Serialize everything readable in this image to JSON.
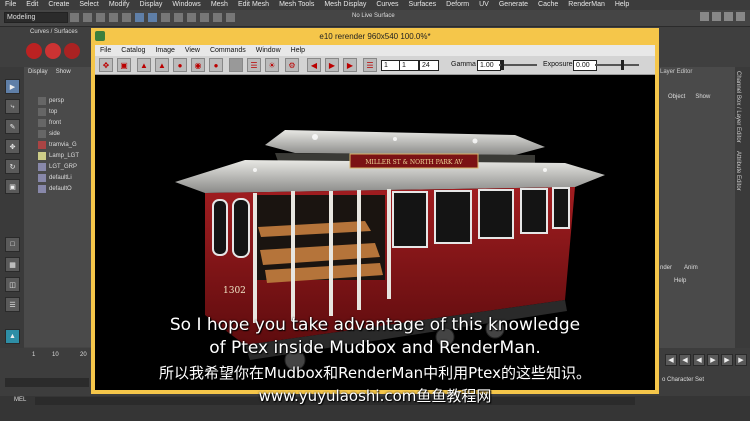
{
  "app_menu": [
    "File",
    "Edit",
    "Create",
    "Select",
    "Modify",
    "Display",
    "Windows",
    "Mesh",
    "Edit Mesh",
    "Mesh Tools",
    "Mesh Display",
    "Curves",
    "Surfaces",
    "Deform",
    "UV",
    "Generate",
    "Cache",
    "RenderMan",
    "Help"
  ],
  "toolbar": {
    "mode_value": "Modeling",
    "live_surface": "No Live Surface"
  },
  "shelf": {
    "tab_label": "Curves / Surfaces"
  },
  "outliner": {
    "menu": [
      "Display",
      "Show"
    ],
    "items": [
      "persp",
      "top",
      "front",
      "side",
      "tramvia_G",
      "Lamp_LGT",
      "LGT_GRP",
      "defaultLi",
      "defaultO"
    ]
  },
  "render_window": {
    "title": "e10 rerender 960x540 100.0%*",
    "menu": [
      "File",
      "Catalog",
      "Image",
      "View",
      "Commands",
      "Window",
      "Help"
    ],
    "frame_start": "1",
    "frame_current": "1",
    "frame_end": "24",
    "gamma_label": "Gamma",
    "gamma_value": "1.00",
    "exposure_label": "Exposure",
    "exposure_value": "0.00",
    "image": {
      "sign_text": "MILLER ST & NORTH PARK AV",
      "car_number": "1302",
      "body_color": "#8a1618"
    }
  },
  "right_panel": {
    "title": "Layer Editor",
    "tabs": [
      "Object",
      "Show"
    ],
    "lower_tabs": [
      "nder",
      "Anim"
    ],
    "lower_item": "Help",
    "side_tabs": [
      "Channel Box / Layer Editor",
      "Attribute Editor"
    ]
  },
  "timeline": {
    "ticks": [
      "1",
      "10",
      "20"
    ],
    "character_set_label": "o Character Set"
  },
  "status": {
    "mel_label": "MEL"
  },
  "subtitles": {
    "line1": "So I hope you take advantage of this knowledge",
    "line2": "of Ptex inside Mudbox and RenderMan.",
    "line3": "所以我希望你在Mudbox和RenderMan中利用Ptex的这些知识。",
    "watermark": "www.yuyulaoshi.com鱼鱼教程网"
  },
  "colors": {
    "window_border": "#f5c64a",
    "accent": "#4a8ed8"
  }
}
